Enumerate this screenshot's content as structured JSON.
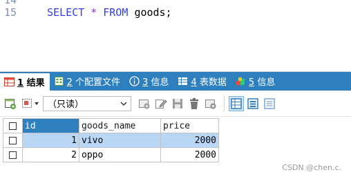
{
  "editor": {
    "partial_line_number": "14",
    "line_number": "15",
    "sql": {
      "kw1": "SELECT",
      "star": "*",
      "kw2": "FROM",
      "table": "goods;"
    }
  },
  "tabs": [
    {
      "num": "1",
      "label": "结果",
      "icon": "result-grid-icon"
    },
    {
      "num": "2",
      "label": "个配置文件",
      "icon": "profile-icon"
    },
    {
      "num": "3",
      "label": "信息",
      "icon": "info-icon"
    },
    {
      "num": "4",
      "label": "表数据",
      "icon": "table-data-icon"
    },
    {
      "num": "5",
      "label": "信息",
      "icon": "info-color-icon"
    }
  ],
  "toolbar": {
    "mode": "（只读）"
  },
  "table": {
    "columns": [
      "id",
      "goods_name",
      "price"
    ],
    "rows": [
      {
        "id": "1",
        "goods_name": "vivo",
        "price": "2000"
      },
      {
        "id": "2",
        "goods_name": "oppo",
        "price": "2000"
      }
    ]
  },
  "watermark": "CSDN @chen.c."
}
